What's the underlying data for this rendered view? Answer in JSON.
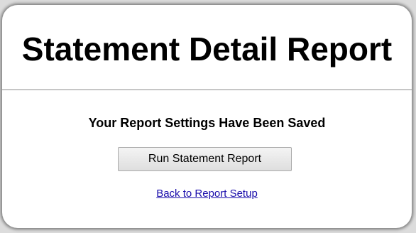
{
  "page": {
    "title": "Statement Detail Report",
    "saved_message": "Your Report Settings Have Been Saved",
    "run_button_label": "Run Statement Report",
    "back_link_label": "Back to Report Setup"
  },
  "colors": {
    "link": "#1a0dab",
    "button_border": "#a9a9a9",
    "divider": "#8c8c8c"
  }
}
